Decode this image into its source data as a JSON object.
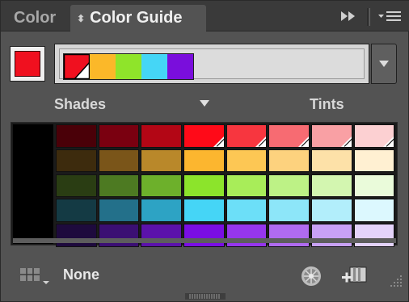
{
  "tabs": [
    {
      "label": "Color",
      "active": false
    },
    {
      "label": "Color Guide",
      "active": true
    }
  ],
  "base_color": "#f0101f",
  "harmony_group": {
    "swatches": [
      "#f0101f",
      "#fbb829",
      "#8fe42a",
      "#45d6f6",
      "#7a0edc"
    ]
  },
  "variation_labels": {
    "left": "Shades",
    "right": "Tints"
  },
  "grid": {
    "base_column_color": "#000000",
    "rows": [
      {
        "cells": [
          "#4a0008",
          "#7a0010",
          "#b30615",
          "#ff0a18",
          "#f7363f",
          "#f76b72",
          "#f9a0a4",
          "#fcd0d2"
        ],
        "marked": [
          3,
          4,
          5,
          6,
          7
        ]
      },
      {
        "cells": [
          "#3d2b0d",
          "#7a5519",
          "#b9882a",
          "#fcb62f",
          "#fdc754",
          "#fdd27e",
          "#fde1a8",
          "#fff0d2"
        ],
        "marked": []
      },
      {
        "cells": [
          "#2a3d13",
          "#4d7a22",
          "#6db02b",
          "#8ce42b",
          "#a8ed59",
          "#bdf286",
          "#d3f6b0",
          "#eafbda"
        ],
        "marked": []
      },
      {
        "cells": [
          "#143a44",
          "#23708a",
          "#2da3c4",
          "#45d5f6",
          "#6cdff8",
          "#8de6f9",
          "#b2eefb",
          "#dcf8fe"
        ],
        "marked": []
      },
      {
        "cells": [
          "#1e0a3d",
          "#3b0f73",
          "#5b12aa",
          "#7a0ee3",
          "#9636ed",
          "#b06bf0",
          "#c8a1f5",
          "#e4d3fa"
        ],
        "marked": []
      }
    ]
  },
  "footer": {
    "swatch_group_label": "None"
  },
  "icons": {
    "fast_forward": "fast-forward-icon",
    "menu": "panel-menu-icon",
    "dropdown": "triangle-down-icon",
    "grid_options": "variation-grid-icon",
    "color_wheel": "color-wheel-icon",
    "save_group": "save-swatch-group-icon",
    "resize": "resize-grip-icon"
  }
}
